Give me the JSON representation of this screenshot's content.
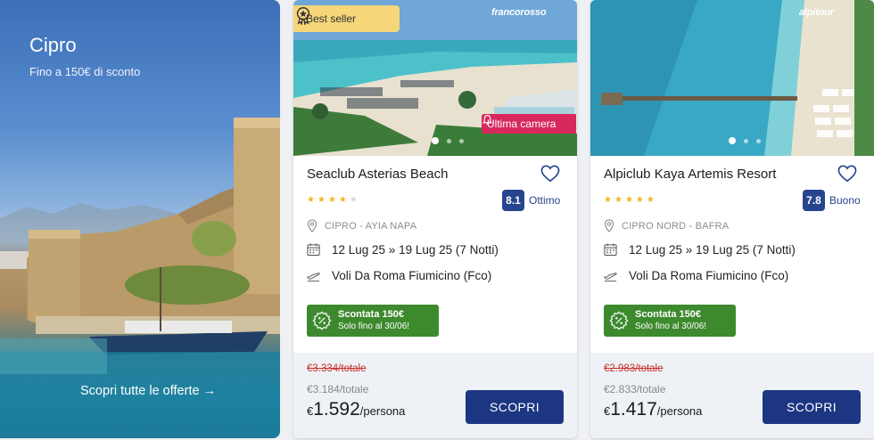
{
  "promo": {
    "title": "Cipro",
    "subtitle": "Fino a 150€ di sconto",
    "cta": "Scopri tutte le offerte",
    "cta_arrow": "→"
  },
  "cards": [
    {
      "brand": "francorosso",
      "best_seller": "Best seller",
      "last_room": "Ultima camera",
      "name": "Seaclub Asterias Beach",
      "stars": 4,
      "score": "8.1",
      "score_label": "Ottimo",
      "location": "CIPRO - AYIA NAPA",
      "dates": "12 Lug 25 » 19 Lug 25 (7 Notti)",
      "flight": "Voli Da Roma Fiumicino (Fco)",
      "discount_title": "Scontata 150€",
      "discount_sub": "Solo fino al 30/06!",
      "price_old": "€3.334/totale",
      "price_mid": "€3.184/totale",
      "price_currency": "€",
      "price_big": "1.592",
      "price_unit": "/persona",
      "button": "SCOPRI"
    },
    {
      "brand": "alpitour",
      "name": "Alpiclub Kaya Artemis Resort",
      "stars": 5,
      "score": "7.8",
      "score_label": "Buono",
      "location": "CIPRO NORD - BAFRA",
      "dates": "12 Lug 25 » 19 Lug 25 (7 Notti)",
      "flight": "Voli Da Roma Fiumicino (Fco)",
      "discount_title": "Scontata 150€",
      "discount_sub": "Solo fino al 30/06!",
      "price_old": "€2.983/totale",
      "price_mid": "€2.833/totale",
      "price_currency": "€",
      "price_big": "1.417",
      "price_unit": "/persona",
      "button": "SCOPRI"
    }
  ],
  "colors": {
    "accent": "#1c3681",
    "score_bg": "#27458f",
    "discount_green": "#3d8a2e",
    "last_room_red": "#d8285c",
    "best_seller_yellow": "#f5d679",
    "price_strike": "#c7322b"
  }
}
